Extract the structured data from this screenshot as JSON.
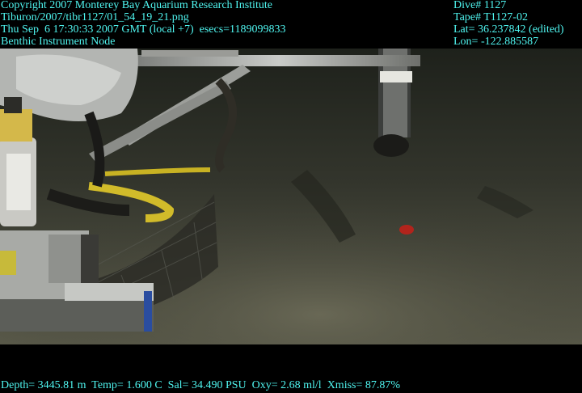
{
  "overlay": {
    "top_left": [
      "Copyright 2007 Monterey Bay Aquarium Research Institute",
      "Tiburon/2007/tibr1127/01_54_19_21.png",
      "Thu Sep  6 17:30:33 2007 GMT (local +7)  esecs=1189099833",
      "Benthic Instrument Node"
    ],
    "top_right": [
      "Dive# 1127",
      "Tape# T1127-02",
      "Lat= 36.237842 (edited)",
      "Lon= -122.885587"
    ],
    "bottom": "Depth= 3445.81 m  Temp= 1.600 C  Sal= 34.490 PSU  Oxy= 2.68 ml/l  Xmiss= 87.87%"
  },
  "colors": {
    "overlay_text": "#4ff5f0",
    "seafloor": "#4a4a3c",
    "water": "#23261f"
  }
}
